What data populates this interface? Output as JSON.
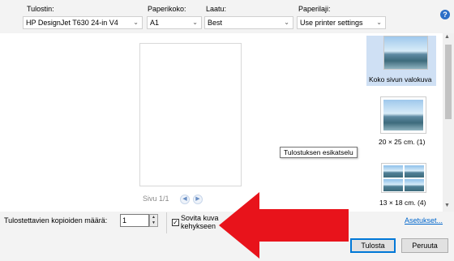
{
  "header": {
    "printer_label": "Tulostin:",
    "printer_value": "HP DesignJet T630 24-in V4",
    "paper_size_label": "Paperikoko:",
    "paper_size_value": "A1",
    "quality_label": "Laatu:",
    "quality_value": "Best",
    "paper_type_label": "Paperilaji:",
    "paper_type_value": "Use printer settings",
    "help_symbol": "?"
  },
  "preview": {
    "page_indicator": "Sivu 1/1",
    "prev_symbol": "◀",
    "next_symbol": "▶",
    "tooltip": "Tulostuksen esikatselu"
  },
  "layouts": [
    {
      "label": "Koko sivun valokuva",
      "selected": true
    },
    {
      "label": "20 × 25 cm. (1)",
      "selected": false
    },
    {
      "label": "13 × 18 cm. (4)",
      "selected": false
    }
  ],
  "footer": {
    "copies_label": "Tulostettavien kopioiden määrä:",
    "copies_value": "1",
    "fit_label": "Sovita kuva kehykseen",
    "fit_checked": true,
    "settings_link": "Asetukset...",
    "print_button": "Tulosta",
    "cancel_button": "Peruuta"
  },
  "colors": {
    "accent": "#0078d7",
    "arrow": "#e8131b",
    "selection": "#cfe0f4"
  }
}
